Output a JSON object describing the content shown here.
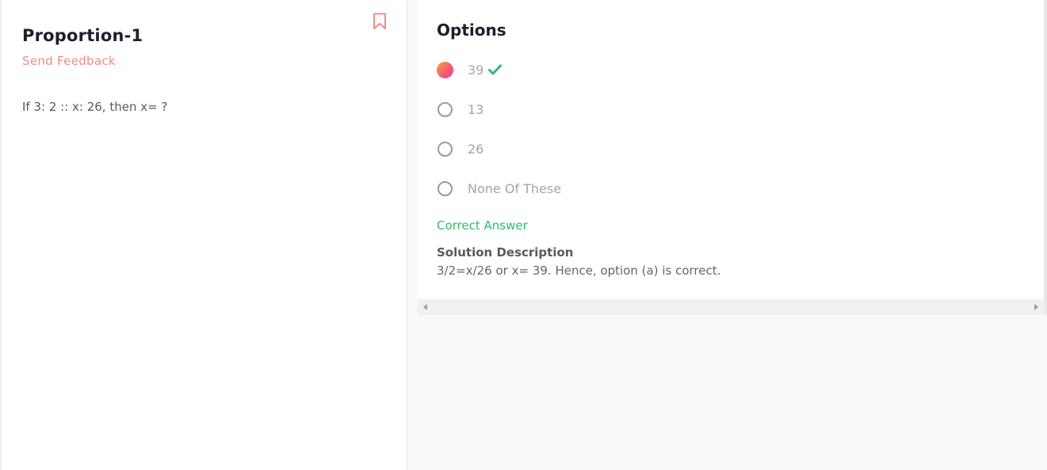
{
  "question": {
    "title": "Proportion-1",
    "feedback_label": "Send Feedback",
    "text": "If 3: 2 :: x: 26, then x= ?",
    "bookmark_icon": "bookmark-icon"
  },
  "options": {
    "heading": "Options",
    "items": [
      {
        "label": "39",
        "selected": true,
        "correct": true
      },
      {
        "label": "13",
        "selected": false
      },
      {
        "label": "26",
        "selected": false
      },
      {
        "label": "None Of These",
        "selected": false
      }
    ]
  },
  "result": {
    "correct_label": "Correct Answer",
    "solution_title": "Solution Description",
    "solution_text": "3/2=x/26 or x= 39. Hence, option (a) is correct."
  },
  "colors": {
    "accent": "#f08a8a",
    "success": "#2ebd6b",
    "selected_gradient_start": "#f9a43c",
    "selected_gradient_end": "#ee3f86"
  }
}
